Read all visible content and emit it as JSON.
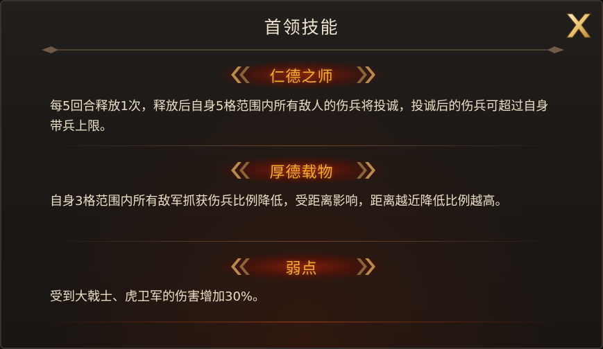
{
  "dialog": {
    "title": "首领技能",
    "close_icon": "close-x-icon"
  },
  "skills": [
    {
      "name": "仁德之师",
      "description": "每5回合释放1次，释放后自身5格范围内所有敌人的伤兵将投诚，投诚后的伤兵可超过自身带兵上限。"
    },
    {
      "name": "厚德载物",
      "description": "自身3格范围内所有敌军抓获伤兵比例降低，受距离影响，距离越近降低比例越高。"
    },
    {
      "name": "弱点",
      "description": "受到大戟士、虎卫军的伤害增加30%。"
    }
  ],
  "colors": {
    "accent_gold": "#f5ab32",
    "text_light": "#ecdfc8",
    "title_text": "#efe4d1",
    "header_glow": "#8c1e0a"
  }
}
